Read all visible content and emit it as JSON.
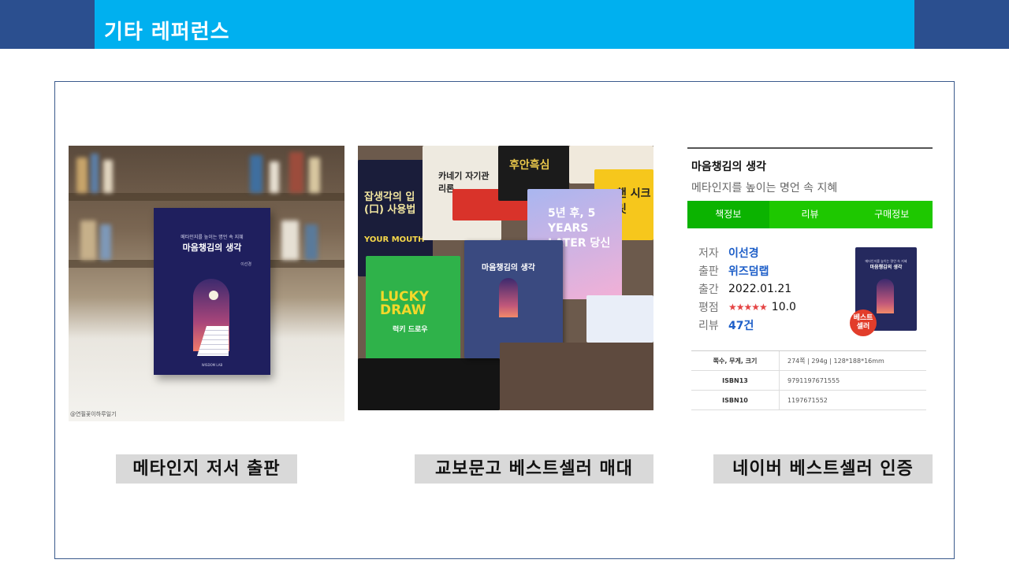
{
  "header": {
    "title": "기타 레퍼런스"
  },
  "photo1": {
    "book_subtitle": "메타인지를 높이는 명언 속 지혜",
    "book_title": "마음챙김의 생각",
    "author": "이선경",
    "publisher": "WISDOM LAB",
    "watermark": "@연필꽃이하루일기"
  },
  "photo2": {
    "books": [
      {
        "title": "잡생각의 입(口) 사용법",
        "extra": "YOUR MOUTH"
      },
      {
        "title": "카네기 자기관리론",
        "extra": ""
      },
      {
        "title": "후안흑심",
        "extra": ""
      },
      {
        "title": "LUCKY DRAW",
        "extra": "럭키 드로우"
      },
      {
        "title": "마음챙김의 생각",
        "extra": ""
      },
      {
        "title": "5년 후, 5 YEARS LATER 당신은",
        "extra": ""
      },
      {
        "title": "챈 시크릿",
        "extra": ""
      }
    ]
  },
  "naver": {
    "title": "마음챙김의 생각",
    "subtitle": "메타인지를 높이는 명언 속 지혜",
    "tabs": [
      "책정보",
      "리뷰",
      "구매정보"
    ],
    "author_label": "저자",
    "author": "이선경",
    "publisher_label": "출판",
    "publisher": "위즈덤랩",
    "date_label": "출간",
    "date": "2022.01.21",
    "rating_label": "평점",
    "stars": "★★★★★",
    "rating": "10.0",
    "review_label": "리뷰",
    "review_count": "47건",
    "badge": "베스트 셀러",
    "cover_subtitle": "메타인지를 높이는 명언 속 지혜",
    "cover_title": "마음챙김의 생각",
    "table": [
      {
        "label": "쪽수, 무게, 크기",
        "value": "274쪽 | 294g | 128*188*16mm"
      },
      {
        "label": "ISBN13",
        "value": "9791197671555"
      },
      {
        "label": "ISBN10",
        "value": "1197671552"
      }
    ]
  },
  "captions": [
    "메타인지 저서 출판",
    "교보문고 베스트셀러 매대",
    "네이버 베스트셀러 인증"
  ]
}
